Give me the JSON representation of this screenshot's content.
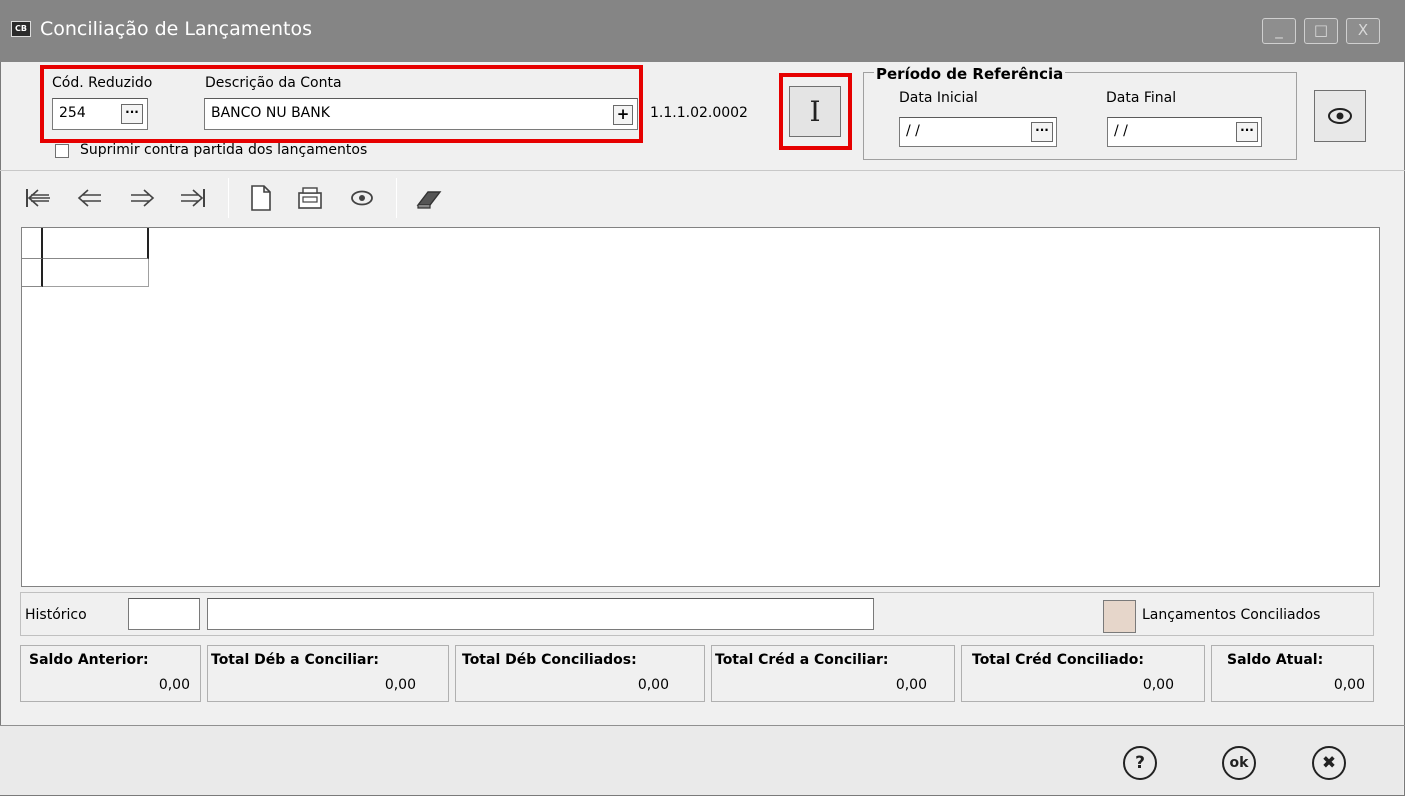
{
  "window": {
    "title": "Conciliação de Lançamentos",
    "app_icon_text": "CB",
    "minimize_glyph": "_",
    "maximize_glyph": "□",
    "close_glyph": "X"
  },
  "account": {
    "cod_label": "Cód. Reduzido",
    "cod_value": "254",
    "desc_label": "Descrição da Conta",
    "desc_value": "BANCO NU BANK",
    "plus_glyph": "+",
    "dots_glyph": "···",
    "account_code": "1.1.1.02.0002",
    "suppress_label": "Suprimir contra partida dos lançamentos"
  },
  "import_button_glyph": "I",
  "period": {
    "title": "Período de Referência",
    "start_label": "Data Inicial",
    "start_value": "/ /",
    "end_label": "Data Final",
    "end_value": "/ /"
  },
  "footer": {
    "historico_label": "Histórico",
    "historico_code": "",
    "historico_text": "",
    "legend_label": "Lançamentos Conciliados",
    "legend_color": "#e6d6ca"
  },
  "totals": [
    {
      "label": "Saldo Anterior:",
      "value": "0,00"
    },
    {
      "label": "Total Déb a Conciliar:",
      "value": "0,00"
    },
    {
      "label": "Total Déb Conciliados:",
      "value": "0,00"
    },
    {
      "label": "Total Créd a Conciliar:",
      "value": "0,00"
    },
    {
      "label": "Total Créd Conciliado:",
      "value": "0,00"
    },
    {
      "label": "Saldo Atual:",
      "value": "0,00"
    }
  ],
  "bottom_buttons": {
    "help_glyph": "?",
    "ok_glyph": "ok",
    "cancel_glyph": "✖"
  },
  "colors": {
    "highlight": "#e60000",
    "titlebar": "#858585"
  }
}
